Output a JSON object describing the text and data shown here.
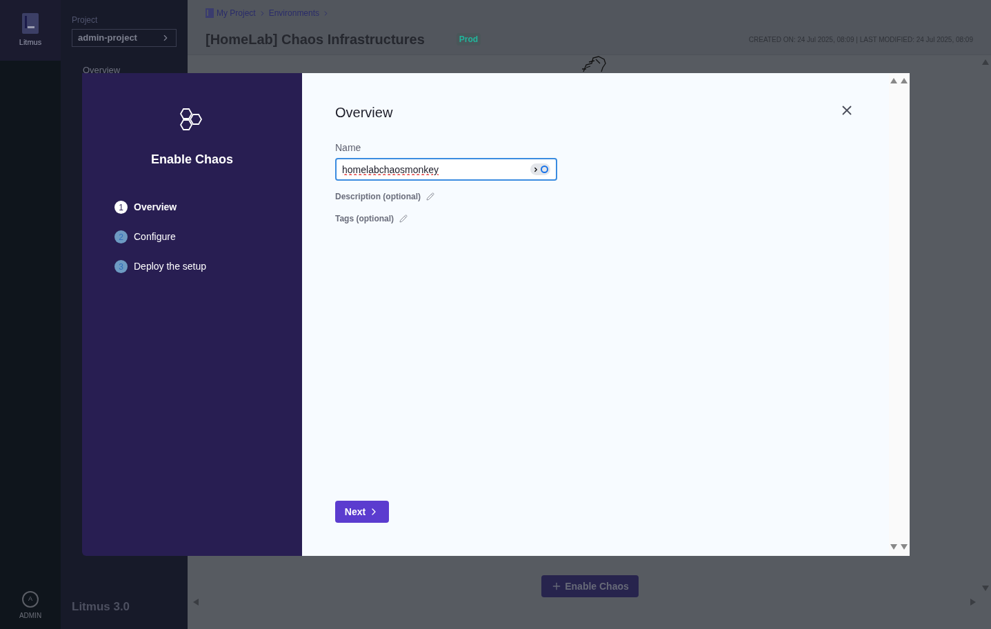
{
  "app": {
    "name": "Litmus",
    "version": "Litmus 3.0",
    "user": "ADMIN",
    "avatar_letter": "A"
  },
  "project": {
    "label": "Project",
    "value": "admin-project"
  },
  "nav": {
    "overview": "Overview"
  },
  "breadcrumbs": [
    "My Project",
    "Environments"
  ],
  "page": {
    "title": "[HomeLab] Chaos Infrastructures",
    "tag": "Prod",
    "meta": "CREATED ON: 24 Jul 2025, 08:09 | LAST MODIFIED: 24 Jul 2025, 08:09",
    "action": "Enable Chaos"
  },
  "dialog": {
    "title": "Enable Chaos",
    "heading": "Overview",
    "steps": [
      {
        "number": "1",
        "label": "Overview",
        "selected": true
      },
      {
        "number": "2",
        "label": "Configure",
        "selected": false
      },
      {
        "number": "3",
        "label": "Deploy the setup",
        "selected": false
      }
    ],
    "name_label": "Name",
    "name_value": "homelabchaosmonkey",
    "optional_fields": [
      "Description (optional)",
      "Tags (optional)"
    ],
    "next": "Next"
  }
}
